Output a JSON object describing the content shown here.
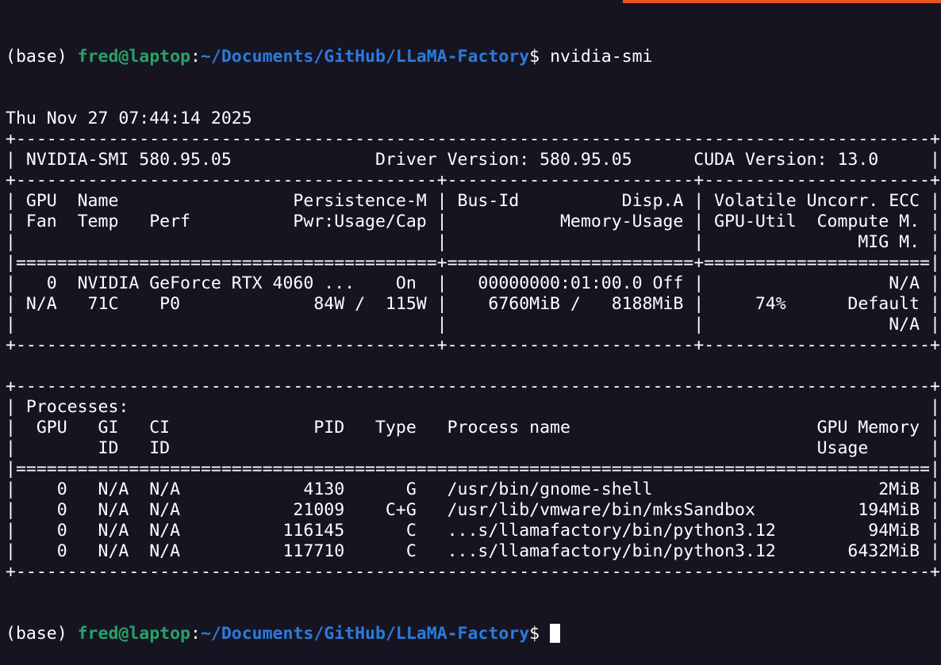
{
  "colors": {
    "background": "#171421",
    "foreground": "#ffffff",
    "user_host": "#26a269",
    "path": "#2a7bde",
    "accent_bar": "#e95420",
    "cursor": "#ffffff"
  },
  "prompt": {
    "env": "(base) ",
    "user_host": "fred@laptop",
    "colon": ":",
    "path": "~/Documents/GitHub/LLaMA-Factory",
    "symbol": "$ ",
    "command": "nvidia-smi"
  },
  "output_lines": [
    "Thu Nov 27 07:44:14 2025",
    "+-----------------------------------------------------------------------------------------+",
    "| NVIDIA-SMI 580.95.05              Driver Version: 580.95.05      CUDA Version: 13.0     |",
    "+-----------------------------------------+------------------------+----------------------+",
    "| GPU  Name                 Persistence-M | Bus-Id          Disp.A | Volatile Uncorr. ECC |",
    "| Fan  Temp   Perf          Pwr:Usage/Cap |           Memory-Usage | GPU-Util  Compute M. |",
    "|                                         |                        |               MIG M. |",
    "|=========================================+========================+======================|",
    "|   0  NVIDIA GeForce RTX 4060 ...    On  |   00000000:01:00.0 Off |                  N/A |",
    "| N/A   71C    P0             84W /  115W |    6760MiB /   8188MiB |     74%      Default |",
    "|                                         |                        |                  N/A |",
    "+-----------------------------------------+------------------------+----------------------+",
    "",
    "+-----------------------------------------------------------------------------------------+",
    "| Processes:                                                                              |",
    "|  GPU   GI   CI              PID   Type   Process name                        GPU Memory |",
    "|        ID   ID                                                               Usage      |",
    "|=========================================================================================|",
    "|    0   N/A  N/A            4130      G   /usr/bin/gnome-shell                      2MiB |",
    "|    0   N/A  N/A           21009    C+G   /usr/lib/vmware/bin/mksSandbox          194MiB |",
    "|    0   N/A  N/A          116145      C   ...s/llamafactory/bin/python3.12         94MiB |",
    "|    0   N/A  N/A          117710      C   ...s/llamafactory/bin/python3.12       6432MiB |",
    "+-----------------------------------------------------------------------------------------+"
  ]
}
